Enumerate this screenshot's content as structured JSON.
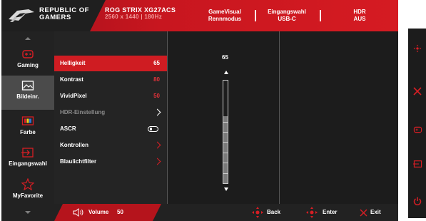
{
  "header": {
    "brand_line1": "REPUBLIC OF",
    "brand_line2": "GAMERS",
    "model": "ROG STRIX XG27ACS",
    "resolution": "2560 x 1440",
    "refresh": "180Hz",
    "gamevisual_label": "GameVisual",
    "gamevisual_value": "Rennmodus",
    "input_label": "Eingangswahl",
    "input_value": "USB-C",
    "hdr_label": "HDR",
    "hdr_value": "AUS"
  },
  "sidebar": {
    "items": [
      {
        "label": "Gaming",
        "icon": "gamepad-icon"
      },
      {
        "label": "Bildeinr.",
        "icon": "picture-icon"
      },
      {
        "label": "Farbe",
        "icon": "color-icon"
      },
      {
        "label": "Eingangswahl",
        "icon": "input-icon"
      },
      {
        "label": "MyFavorite",
        "icon": "star-icon"
      }
    ],
    "active_index": 1
  },
  "menu": {
    "items": [
      {
        "label": "Helligkeit",
        "value": "65"
      },
      {
        "label": "Kontrast",
        "value": "80"
      },
      {
        "label": "VividPixel",
        "value": "50"
      },
      {
        "label": "HDR-Einstellung"
      },
      {
        "label": "ASCR"
      },
      {
        "label": "Kontrollen"
      },
      {
        "label": "Blaulichtfilter"
      }
    ],
    "active_index": 0
  },
  "slider": {
    "value": "65",
    "level": 0.65
  },
  "footer": {
    "volume_label": "Volume",
    "volume_value": "50",
    "back_label": "Back",
    "enter_label": "Enter",
    "exit_label": "Exit"
  },
  "colors": {
    "accent": "#cf1c22",
    "background": "#1a1a1a",
    "sidebar_active": "#4b4b4b"
  },
  "quick_keys": [
    "navigate-icon",
    "close-icon",
    "gamepad-icon",
    "input-icon",
    "power-icon"
  ]
}
